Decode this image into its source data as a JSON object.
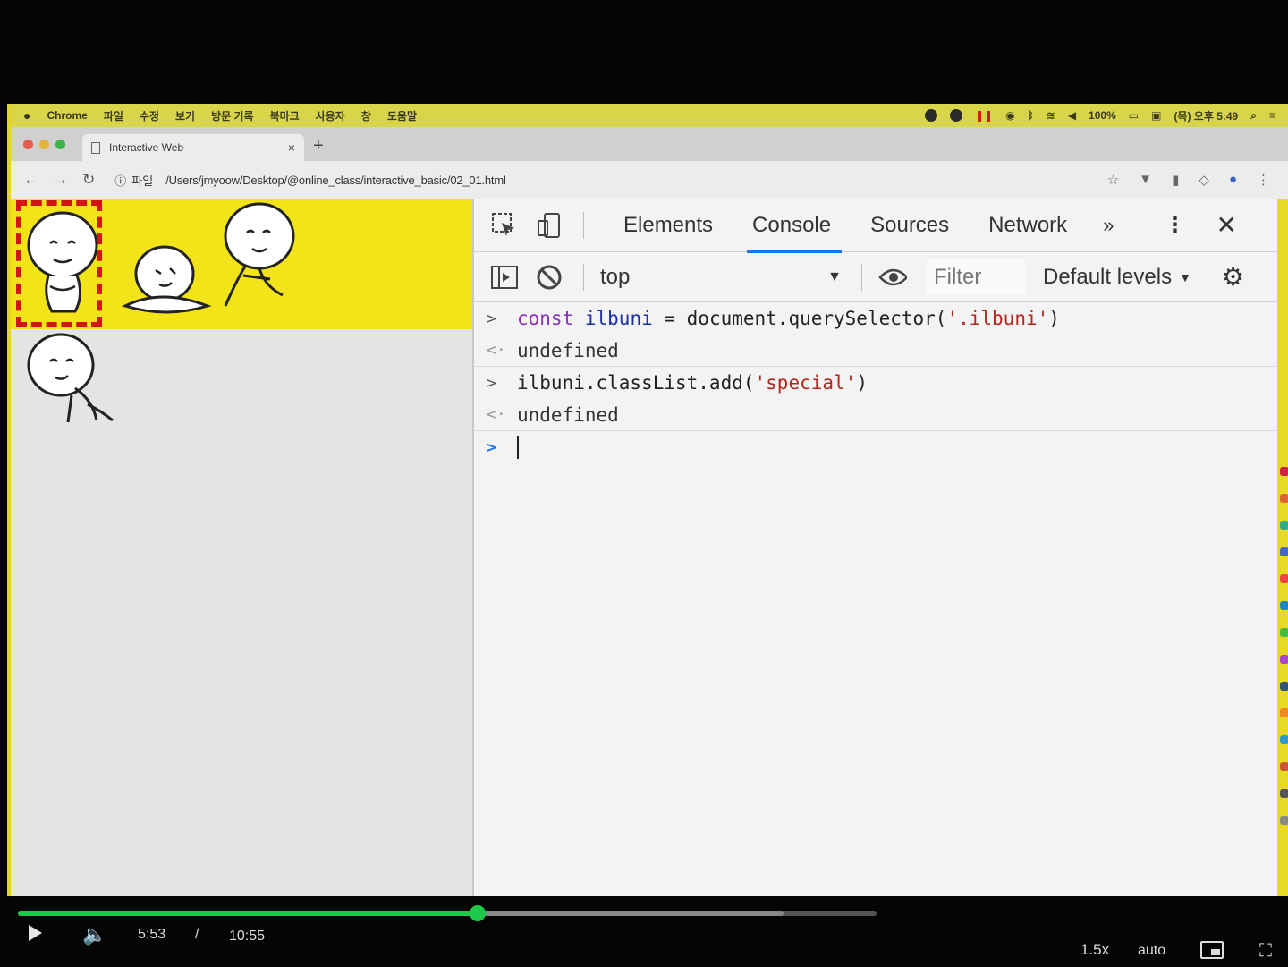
{
  "menubar": {
    "app": "Chrome",
    "items": [
      "파일",
      "수정",
      "보기",
      "방문 기록",
      "북마크",
      "사용자",
      "창",
      "도움말"
    ],
    "battery": "100%",
    "clock": "(목) 오후 5:49"
  },
  "tab": {
    "title": "Interactive Web",
    "close": "×",
    "new_tab": "+"
  },
  "address": {
    "scheme_label": "파일",
    "url": "/Users/jmyoow/Desktop/@online_class/interactive_basic/02_01.html"
  },
  "devtools": {
    "tabs": [
      "Elements",
      "Console",
      "Sources",
      "Network"
    ],
    "active_tab": "Console",
    "more": "»",
    "context": "top",
    "filter_placeholder": "Filter",
    "levels": "Default levels"
  },
  "console": {
    "lines": [
      {
        "kind": "input",
        "keyword": "const",
        "var": "ilbuni",
        "rest_a": " = document.querySelector(",
        "string": "'.ilbuni'",
        "rest_b": ")"
      },
      {
        "kind": "result",
        "text": "undefined"
      },
      {
        "kind": "input",
        "keyword": "",
        "var": "",
        "rest_a": "ilbuni.classList.add(",
        "string": "'special'",
        "rest_b": ")"
      },
      {
        "kind": "result",
        "text": "undefined"
      }
    ]
  },
  "player": {
    "current": "5:53",
    "separator": "/",
    "total": "10:55",
    "progress_fraction": 0.535,
    "buffered_fraction": 0.892,
    "speed": "1.5x",
    "quality": "auto"
  },
  "colors": {
    "accent": "#1a73e8",
    "progress": "#1ec94a",
    "page_yellow": "#f2e418",
    "special_border": "#d21414"
  }
}
